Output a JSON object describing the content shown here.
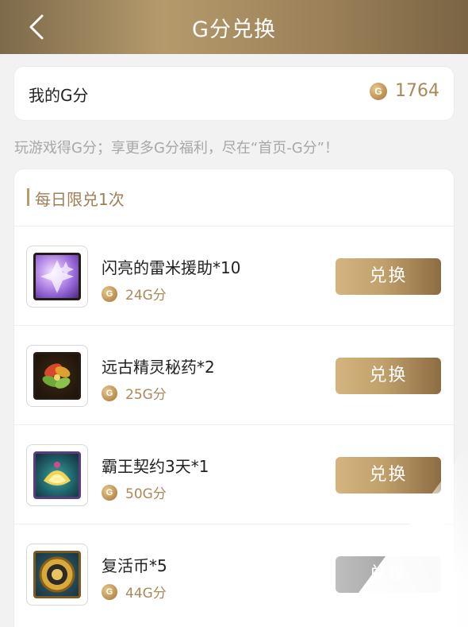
{
  "header": {
    "title": "G分兑换",
    "back_icon": "chevron-left-icon"
  },
  "g_points": {
    "label": "我的G分",
    "coin_glyph": "G",
    "value": "1764"
  },
  "tip": "玩游戏得G分；享更多G分福利，尽在“首页-G分”！",
  "section": {
    "title": "每日限兑1次"
  },
  "items": [
    {
      "name": "闪亮的雷米援助*10",
      "cost": "24G分",
      "button": "兑换",
      "icon": "purple-crystal-icon"
    },
    {
      "name": "远古精灵秘药*2",
      "cost": "25G分",
      "button": "兑换",
      "icon": "herb-potion-icon"
    },
    {
      "name": "霸王契约3天*1",
      "cost": "50G分",
      "button": "兑换",
      "icon": "golden-contract-icon"
    },
    {
      "name": "复活币*5",
      "cost": "44G分",
      "button": "兑换",
      "icon": "revive-coin-icon"
    }
  ],
  "colors": {
    "accent_gold": "#a98a58",
    "header_gradient_start": "#7c6a4b",
    "header_gradient_end": "#7a6444"
  }
}
